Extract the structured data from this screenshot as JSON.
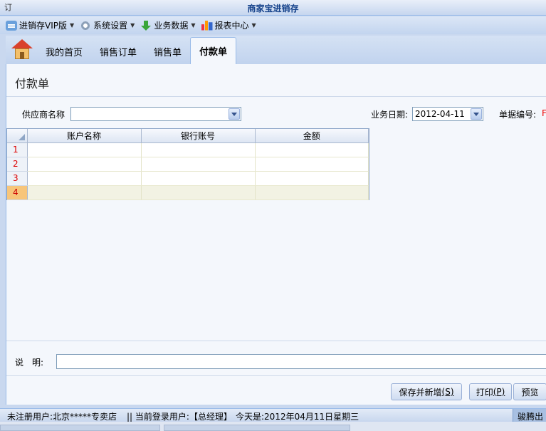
{
  "window": {
    "title": "商家宝进销存",
    "app_icon_text": "订"
  },
  "menubar": {
    "items": [
      {
        "label": "进销存VIP版",
        "icon": "chat-icon"
      },
      {
        "label": "系统设置",
        "icon": "gear-icon"
      },
      {
        "label": "业务数据",
        "icon": "download-arrow-icon"
      },
      {
        "label": "报表中心",
        "icon": "bar-chart-icon"
      }
    ]
  },
  "tabs": [
    {
      "label": "我的首页"
    },
    {
      "label": "销售订单"
    },
    {
      "label": "销售单"
    },
    {
      "label": "付款单",
      "active": true
    }
  ],
  "form": {
    "title": "付款单",
    "supplier_label": "供应商名称",
    "supplier_value": "",
    "date_label": "业务日期:",
    "date_value": "2012-04-11",
    "doc_no_label": "单据编号:",
    "doc_no_value": "F"
  },
  "grid": {
    "columns": [
      "账户名称",
      "银行账号",
      "金额"
    ],
    "rows": [
      {
        "no": "1",
        "cells": [
          "",
          "",
          ""
        ]
      },
      {
        "no": "2",
        "cells": [
          "",
          "",
          ""
        ]
      },
      {
        "no": "3",
        "cells": [
          "",
          "",
          ""
        ]
      },
      {
        "no": "4",
        "cells": [
          "",
          "",
          ""
        ],
        "selected": true
      }
    ]
  },
  "note": {
    "label": "说　明:",
    "value": ""
  },
  "buttons": {
    "save_new": "保存并新增",
    "save_new_key": "(S)",
    "print": "打印",
    "print_key": "(P)",
    "preview": "预览"
  },
  "statusbar": {
    "user": "未注册用户:北京*****专卖店",
    "login": "|| 当前登录用户:【总经理】",
    "today": "今天是:2012年04月11日星期三",
    "right": "骏腾出"
  }
}
